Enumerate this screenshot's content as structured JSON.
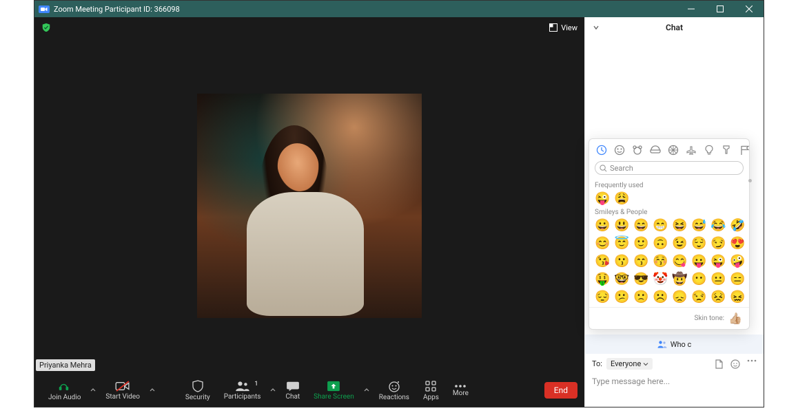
{
  "title_bar": {
    "title": "Zoom Meeting Participant ID: 366098"
  },
  "video": {
    "view_label": "View",
    "participant_name": "Priyanka Mehra"
  },
  "toolbar": {
    "join_audio": "Join Audio",
    "start_video": "Start Video",
    "security": "Security",
    "participants": "Participants",
    "participant_count": "1",
    "chat": "Chat",
    "share_screen": "Share Screen",
    "reactions": "Reactions",
    "apps": "Apps",
    "more": "More",
    "end": "End"
  },
  "chat": {
    "title": "Chat",
    "who_can_see": "Who c",
    "to_label": "To:",
    "to_target": "Everyone",
    "placeholder": "Type message here..."
  },
  "emoji": {
    "search_placeholder": "Search",
    "section_frequent": "Frequently used",
    "section_smileys": "Smileys & People",
    "frequent": [
      "😜",
      "😩"
    ],
    "smileys_rows": [
      [
        "😀",
        "😃",
        "😄",
        "😁",
        "😆",
        "😅",
        "😂",
        "🤣"
      ],
      [
        "😊",
        "😇",
        "🙂",
        "🙃",
        "😉",
        "😌",
        "😏",
        "😍"
      ],
      [
        "😘",
        "😗",
        "😙",
        "😚",
        "😋",
        "😛",
        "😜",
        "🤪"
      ],
      [
        "🤑",
        "🤓",
        "😎",
        "🤡",
        "🤠",
        "😶",
        "😐",
        "😑"
      ],
      [
        "😔",
        "😕",
        "🙁",
        "☹️",
        "😞",
        "😒",
        "😣",
        "😖"
      ]
    ],
    "skin_tone_label": "Skin tone:",
    "skin_tone_emoji": "👍🏼"
  }
}
